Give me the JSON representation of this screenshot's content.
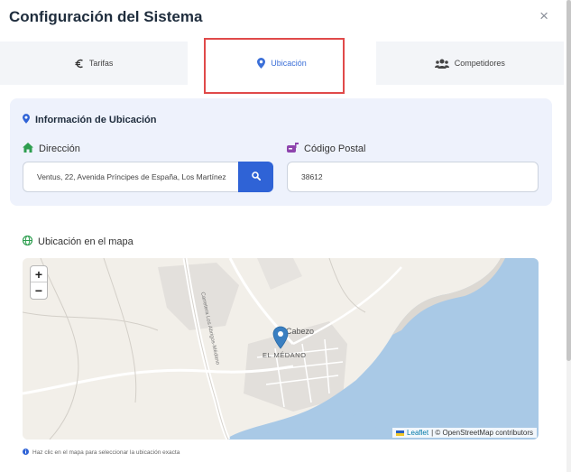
{
  "dialog": {
    "title": "Configuración del Sistema",
    "close_label": "×"
  },
  "tabs": [
    {
      "label": "Tarifas",
      "icon": "euro-icon"
    },
    {
      "label": "Ubicación",
      "icon": "map-marker-icon",
      "active": true
    },
    {
      "label": "Competidores",
      "icon": "users-icon"
    }
  ],
  "location_card": {
    "title": "Información de Ubicación",
    "address_label": "Dirección",
    "address_value": "Ventus, 22, Avenida Príncipes de España, Los Martínez",
    "postal_label": "Código Postal",
    "postal_value": "38612"
  },
  "map": {
    "section_label": "Ubicación en el mapa",
    "zoom_in": "+",
    "zoom_out": "−",
    "place_label_1": "Cabezo",
    "place_label_2": "EL MÉDANO",
    "road_label": "Carretera Los Abrigos-Médano",
    "attribution_leaflet": "Leaflet",
    "attribution_rest": "| © OpenStreetMap contributors",
    "hint": "Haz clic en el mapa para seleccionar la ubicación exacta"
  },
  "colors": {
    "accent": "#2f63d6",
    "tab_active_text": "#3b6fd8",
    "card_bg": "#eef2fc",
    "highlight_border": "#e04a4a",
    "home_icon": "#2e9e4f",
    "postal_icon": "#8e44ad",
    "globe_icon": "#2e9e4f",
    "sea": "#a9c9e6"
  }
}
